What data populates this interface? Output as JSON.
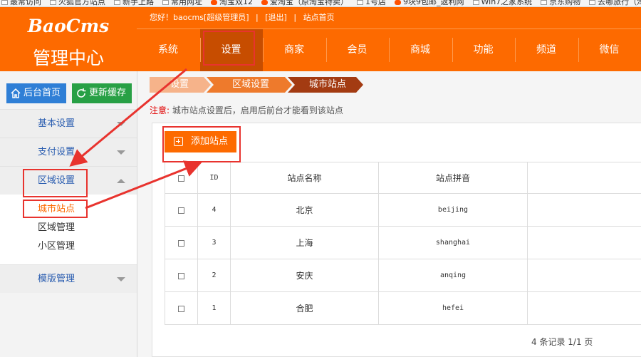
{
  "bookmarks": [
    {
      "label": "最常访问",
      "icon": "page-icon",
      "tb": false
    },
    {
      "label": "火狐官方站点",
      "icon": "page-icon",
      "tb": false
    },
    {
      "label": "新手上路",
      "icon": "page-icon",
      "tb": false
    },
    {
      "label": "常用网址",
      "icon": "page-icon",
      "tb": false
    },
    {
      "label": "淘宝双12",
      "icon": "taobao-icon",
      "tb": true
    },
    {
      "label": "爱淘宝（原淘宝特卖）",
      "icon": "taobao-icon",
      "tb": true
    },
    {
      "label": "1号店",
      "icon": "page-icon",
      "tb": false
    },
    {
      "label": "9块9包邮_返利网",
      "icon": "taobao-icon",
      "tb": true
    },
    {
      "label": "Win7之家系统",
      "icon": "page-icon",
      "tb": false
    },
    {
      "label": "京东购物",
      "icon": "page-icon",
      "tb": false
    },
    {
      "label": "去哪旅行（淘宝",
      "icon": "page-icon",
      "tb": false
    }
  ],
  "header": {
    "brand": "BaoCms",
    "subtitle": "管理中心",
    "greeting": "您好！baocms[超级管理员]",
    "logout": "[退出]",
    "site_home": "站点首页",
    "nav": [
      "系统",
      "设置",
      "商家",
      "会员",
      "商城",
      "功能",
      "频道",
      "微信"
    ],
    "active_nav": "设置"
  },
  "sidebar": {
    "home_button": "后台首页",
    "cache_button": "更新缓存",
    "groups": [
      {
        "label": "基本设置",
        "expanded": false,
        "subs": []
      },
      {
        "label": "支付设置",
        "expanded": false,
        "subs": []
      },
      {
        "label": "区域设置",
        "expanded": true,
        "subs": [
          "城市站点",
          "区域管理",
          "小区管理"
        ]
      },
      {
        "label": "模版管理",
        "expanded": false,
        "subs": []
      }
    ],
    "active_sub": "城市站点"
  },
  "breadcrumbs": [
    "设置",
    "区域设置",
    "城市站点"
  ],
  "notice": {
    "label": "注意:",
    "text": "城市站点设置后，启用后前台才能看到该站点"
  },
  "add_button": "添加站点",
  "table": {
    "columns": [
      "ID",
      "站点名称",
      "站点拼音",
      ""
    ],
    "rows": [
      {
        "id": "4",
        "name": "北京",
        "pinyin": "beijing"
      },
      {
        "id": "3",
        "name": "上海",
        "pinyin": "shanghai"
      },
      {
        "id": "2",
        "name": "安庆",
        "pinyin": "anqing"
      },
      {
        "id": "1",
        "name": "合肥",
        "pinyin": "hefei"
      }
    ]
  },
  "pager": "4 条记录 1/1 页",
  "colors": {
    "header_bg": "#fd6a00",
    "active_nav_bg": "#c74d00",
    "highlight_border": "#e8332e",
    "home_button_bg": "#2f7fd6",
    "cache_button_bg": "#28a045",
    "link_blue": "#2a5db0"
  }
}
